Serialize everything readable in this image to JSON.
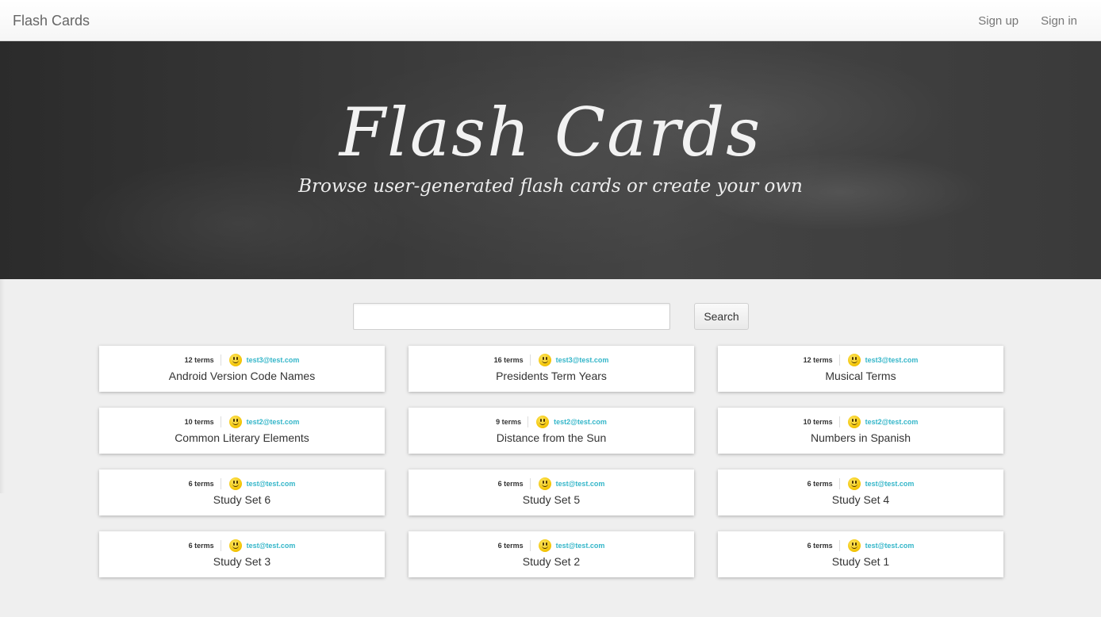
{
  "nav": {
    "brand": "Flash Cards",
    "sign_up": "Sign up",
    "sign_in": "Sign in"
  },
  "hero": {
    "title": "Flash Cards",
    "subtitle": "Browse user-generated flash cards or create your own"
  },
  "search": {
    "value": "",
    "button_label": "Search"
  },
  "colors": {
    "email_accent": "#34b6c9",
    "page_background": "#efefef"
  },
  "cards": [
    {
      "terms": "12 terms",
      "author": "test3@test.com",
      "title": "Android Version Code Names",
      "icon": "smiley-icon"
    },
    {
      "terms": "16 terms",
      "author": "test3@test.com",
      "title": "Presidents Term Years",
      "icon": "smiley-icon"
    },
    {
      "terms": "12 terms",
      "author": "test3@test.com",
      "title": "Musical Terms",
      "icon": "smiley-icon"
    },
    {
      "terms": "10 terms",
      "author": "test2@test.com",
      "title": "Common Literary Elements",
      "icon": "smiley-icon"
    },
    {
      "terms": "9 terms",
      "author": "test2@test.com",
      "title": "Distance from the Sun",
      "icon": "smiley-icon"
    },
    {
      "terms": "10 terms",
      "author": "test2@test.com",
      "title": "Numbers in Spanish",
      "icon": "smiley-icon"
    },
    {
      "terms": "6 terms",
      "author": "test@test.com",
      "title": "Study Set 6",
      "icon": "smiley-icon"
    },
    {
      "terms": "6 terms",
      "author": "test@test.com",
      "title": "Study Set 5",
      "icon": "smiley-icon"
    },
    {
      "terms": "6 terms",
      "author": "test@test.com",
      "title": "Study Set 4",
      "icon": "smiley-icon"
    },
    {
      "terms": "6 terms",
      "author": "test@test.com",
      "title": "Study Set 3",
      "icon": "smiley-icon"
    },
    {
      "terms": "6 terms",
      "author": "test@test.com",
      "title": "Study Set 2",
      "icon": "smiley-icon"
    },
    {
      "terms": "6 terms",
      "author": "test@test.com",
      "title": "Study Set 1",
      "icon": "smiley-icon"
    }
  ]
}
